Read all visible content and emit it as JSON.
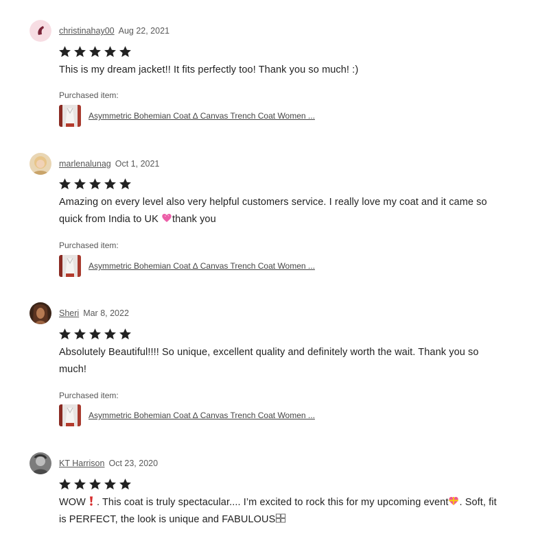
{
  "purchased_label": "Purchased item:",
  "rating_icon": "star-icon",
  "colors": {
    "star": "#222222",
    "text": "#222222",
    "muted": "#595959"
  },
  "reviews": [
    {
      "username": "christinahay00",
      "date": "Aug 22, 2021",
      "rating": 5,
      "text": "This is my dream jacket!! It fits perfectly too! Thank you so much! :)",
      "item_title": "Asymmetric Bohemian Coat ∆ Canvas Trench Coat Women ..."
    },
    {
      "username": "marlenalunag",
      "date": "Oct 1, 2021",
      "rating": 5,
      "text_before": "Amazing on every level also very helpful customers service. I really love my coat and it came so quick from India to UK ",
      "text_after": "thank you",
      "emoji_icon": "pink-heart-emoji",
      "item_title": "Asymmetric Bohemian Coat ∆ Canvas Trench Coat Women ..."
    },
    {
      "username": "Sheri",
      "date": "Mar 8, 2022",
      "rating": 5,
      "text": "Absolutely Beautiful!!!! So unique, excellent quality and definitely worth the wait. Thank you so much!",
      "item_title": "Asymmetric Bohemian Coat ∆ Canvas Trench Coat Women ..."
    },
    {
      "username": "KT Harrison",
      "date": "Oct 23, 2020",
      "rating": 5,
      "text_part1": "WOW",
      "text_part2": ". This coat is truly spectacular.... I’m excited to rock this for my upcoming event",
      "text_part3": ". Soft, fit is PERFECT, the look is unique and FABULOUS",
      "emoji_icons": [
        "red-exclamation-emoji",
        "heart-ribbon-emoji",
        "unknown-glyph-emoji"
      ]
    }
  ]
}
